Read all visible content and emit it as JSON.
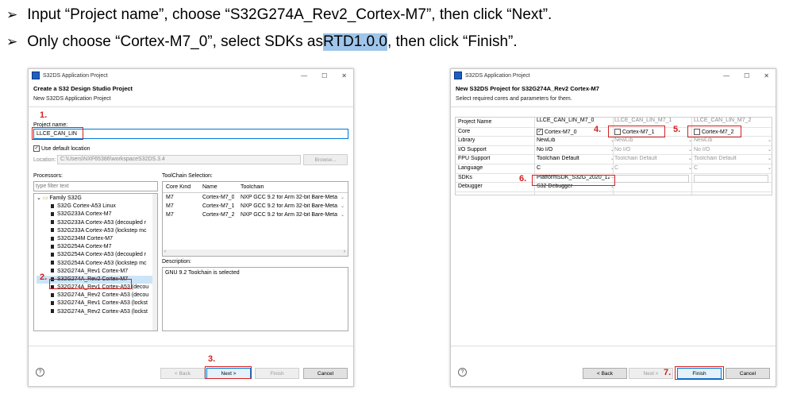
{
  "instructions": {
    "line1": "Input “Project name”, choose “S32G274A_Rev2_Cortex-M7”, then click “Next”.",
    "line2_a": "Only choose “Cortex-M7_0”, select SDKs as ",
    "line2_hl": "RTD1.0.0",
    "line2_b": ", then click “Finish”."
  },
  "left": {
    "window_title": "S32DS Application Project",
    "header_title": "Create a S32 Design Studio Project",
    "header_sub": "New S32DS Application Project",
    "project_name_label": "Project name:",
    "project_name_value": "LLCE_CAN_LIN",
    "use_default_label": "Use default location",
    "location_label": "Location:",
    "location_value": "C:\\Users\\NXF65386\\workspaceS32DS.3.4",
    "browse": "Browse...",
    "processors_label": "Processors:",
    "filter_placeholder": "type filter text",
    "tree_root": "Family S32G",
    "tree_items": [
      "S32G Cortex-A53 Linux",
      "S32G233A Cortex-M7",
      "S32G233A Cortex-A53 (decoupled r",
      "S32G233A Cortex-A53 (lockstep mc",
      "S32G234M Cortex-M7",
      "S32G254A Cortex-M7",
      "S32G254A Cortex-A53 (decoupled r",
      "S32G254A Cortex-A53 (lockstep mc",
      "S32G274A_Rev1 Cortex-M7",
      "S32G274A_Rev2 Cortex-M7",
      "S32G274A_Rev1 Cortex-A53 (decou",
      "S32G274A_Rev2 Cortex-A53 (decou",
      "S32G274A_Rev1 Cortex-A53 (lockst",
      "S32G274A_Rev2 Cortex-A53 (lockst"
    ],
    "toolchain_label": "ToolChain Selection:",
    "tc_headers": [
      "Core Kind",
      "Name",
      "Toolchain"
    ],
    "tc_rows": [
      [
        "M7",
        "Cortex-M7_0",
        "NXP GCC 9.2 for Arm 32-bit Bare-Meta"
      ],
      [
        "M7",
        "Cortex-M7_1",
        "NXP GCC 9.2 for Arm 32-bit Bare-Meta"
      ],
      [
        "M7",
        "Cortex-M7_2",
        "NXP GCC 9.2 for Arm 32-bit Bare-Meta"
      ]
    ],
    "description_label": "Description:",
    "description_value": "GNU 9.2 Toolchain is selected",
    "buttons": {
      "back": "< Back",
      "next": "Next >",
      "finish": "Finish",
      "cancel": "Cancel"
    },
    "steps": {
      "s1": "1.",
      "s2": "2.",
      "s3": "3."
    }
  },
  "right": {
    "window_title": "S32DS Application Project",
    "header_title": "New S32DS Project for S32G274A_Rev2 Cortex-M7",
    "header_sub": "Select required cores and parameters for them.",
    "col_headers": [
      "LLCE_CAN_LIN_M7_0",
      "LLCE_CAN_LIN_M7_1",
      "LLCE_CAN_LIN_M7_2"
    ],
    "row_labels": [
      "Project Name",
      "Core",
      "Library",
      "I/O Support",
      "FPU Support",
      "Language",
      "SDKs",
      "Debugger"
    ],
    "col0": [
      "Cortex-M7_0",
      "NewLib",
      "No I/O",
      "Toolchain Default",
      "C",
      "PlatformSDK_S32G_2020_12...",
      "S32 Debugger"
    ],
    "col1": [
      "Cortex-M7_1",
      "NewLib",
      "No I/O",
      "Toolchain Default",
      "C"
    ],
    "col2": [
      "Cortex-M7_2",
      "NewLib",
      "No I/O",
      "Toolchain Default",
      "C"
    ],
    "buttons": {
      "back": "< Back",
      "next": "Next >",
      "finish": "Finish",
      "cancel": "Cancel"
    },
    "steps": {
      "s4": "4.",
      "s5": "5.",
      "s6": "6.",
      "s7": "7."
    }
  }
}
